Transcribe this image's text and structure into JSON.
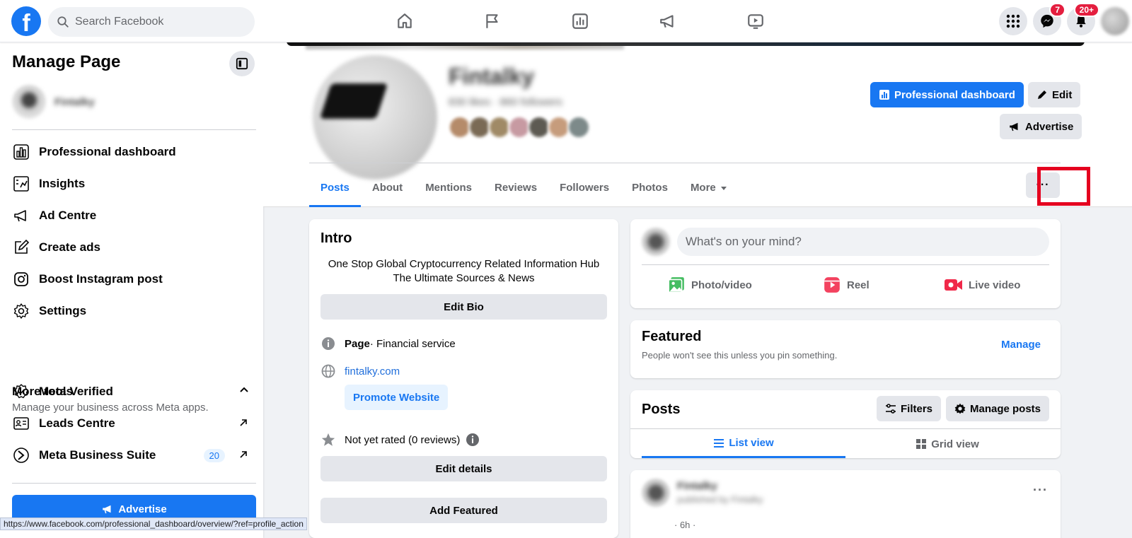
{
  "topbar": {
    "logo": "f",
    "search_placeholder": "Search Facebook",
    "nav_icons": [
      "home-icon",
      "flag-icon",
      "insights-icon",
      "megaphone-icon",
      "video-icon"
    ],
    "messenger_badge": "7",
    "notifications_badge": "20+"
  },
  "sidebar": {
    "title": "Manage Page",
    "page_name": "Fintalky",
    "items": [
      {
        "label": "Professional dashboard",
        "icon": "dashboard-icon"
      },
      {
        "label": "Insights",
        "icon": "insights-icon"
      },
      {
        "label": "Ad Centre",
        "icon": "megaphone-icon"
      },
      {
        "label": "Create ads",
        "icon": "pencil-square-icon"
      },
      {
        "label": "Boost Instagram post",
        "icon": "instagram-icon"
      },
      {
        "label": "Settings",
        "icon": "gear-icon"
      }
    ],
    "more_tools": {
      "title": "More tools",
      "subtitle": "Manage your business across Meta apps.",
      "items": [
        {
          "label": "Meta Verified",
          "icon": "verified-badge-icon"
        },
        {
          "label": "Leads Centre",
          "icon": "leads-card-icon"
        },
        {
          "label": "Meta Business Suite",
          "icon": "business-suite-icon",
          "count": "20"
        }
      ]
    },
    "advertise_label": "Advertise"
  },
  "status_url": "https://www.facebook.com/professional_dashboard/overview/?ref=profile_action",
  "profile": {
    "name": "Fintalky",
    "subtitle": "830 likes · 860 followers",
    "professional_dashboard_label": "Professional dashboard",
    "edit_label": "Edit",
    "advertise_label": "Advertise",
    "tabs": [
      "Posts",
      "About",
      "Mentions",
      "Reviews",
      "Followers",
      "Photos",
      "More"
    ],
    "active_tab": "Posts",
    "more_options_label": "···"
  },
  "intro": {
    "title": "Intro",
    "bio": "One Stop Global Cryptocurrency Related Information Hub The Ultimate Sources & News",
    "edit_bio_label": "Edit Bio",
    "category_prefix": "Page",
    "category": " · Financial service",
    "website": "fintalky.com",
    "promote_label": "Promote Website",
    "rating": "Not yet rated (0 reviews)",
    "edit_details_label": "Edit details",
    "add_featured_label": "Add Featured"
  },
  "composer": {
    "placeholder": "What's on your mind?",
    "photo_label": "Photo/video",
    "reel_label": "Reel",
    "live_label": "Live video"
  },
  "featured": {
    "title": "Featured",
    "subtitle": "People won't see this unless you pin something.",
    "manage_label": "Manage"
  },
  "posts": {
    "title": "Posts",
    "filters_label": "Filters",
    "manage_posts_label": "Manage posts",
    "list_view_label": "List view",
    "grid_view_label": "Grid view"
  },
  "post": {
    "author": "Fintalky",
    "sub": "published by Fintalky",
    "time": "· 6h ·"
  },
  "colors": {
    "brand": "#1877f2",
    "highlight": "#e5001f",
    "badge": "#e41e3f"
  }
}
